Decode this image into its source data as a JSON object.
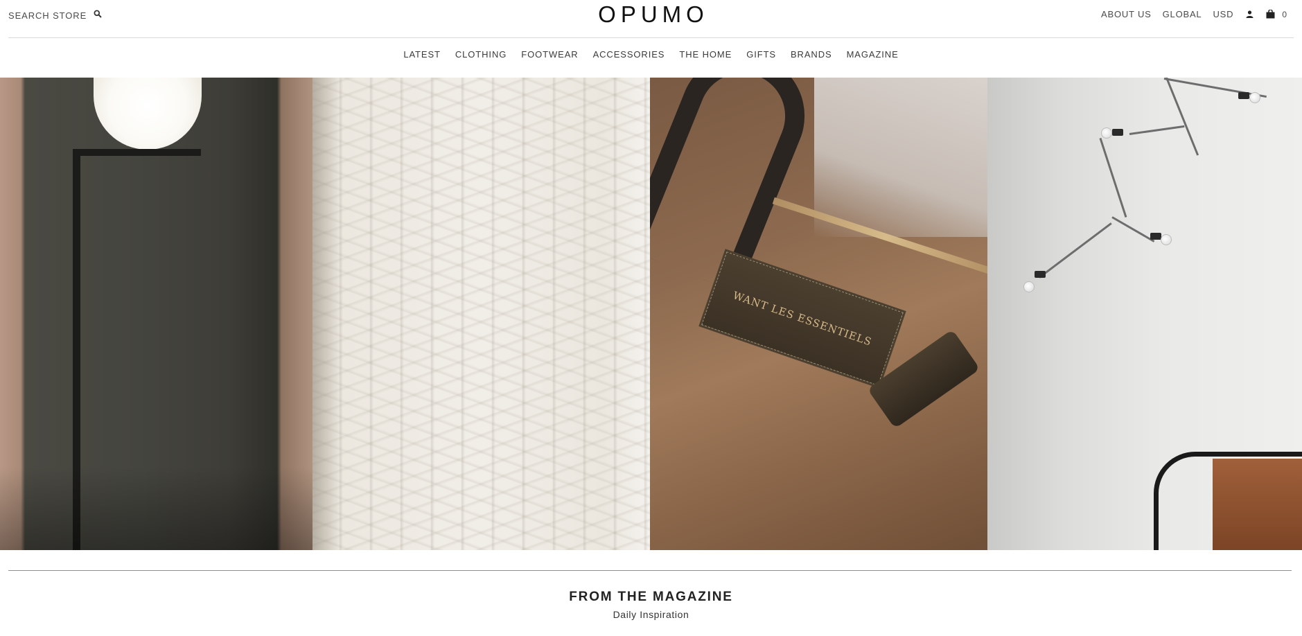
{
  "header": {
    "search_label": "SEARCH STORE",
    "logo_text": "OPUMO",
    "utility_links": [
      "ABOUT US",
      "GLOBAL",
      "USD"
    ],
    "cart_count": "0"
  },
  "nav": {
    "items": [
      "LATEST",
      "CLOTHING",
      "FOOTWEAR",
      "ACCESSORIES",
      "THE HOME",
      "GIFTS",
      "BRANDS",
      "MAGAZINE"
    ]
  },
  "hero": {
    "panels": [
      "floor-lamp",
      "knit-sweater",
      "leather-bag",
      "chandelier"
    ],
    "bag_patch_text": "WANT LES ESSENTIELS"
  },
  "magazine": {
    "title": "FROM THE MAGAZINE",
    "subtitle": "Daily Inspiration"
  },
  "colors": {
    "text": "#333333",
    "logo": "#111111",
    "rule": "#d9d9d9"
  }
}
